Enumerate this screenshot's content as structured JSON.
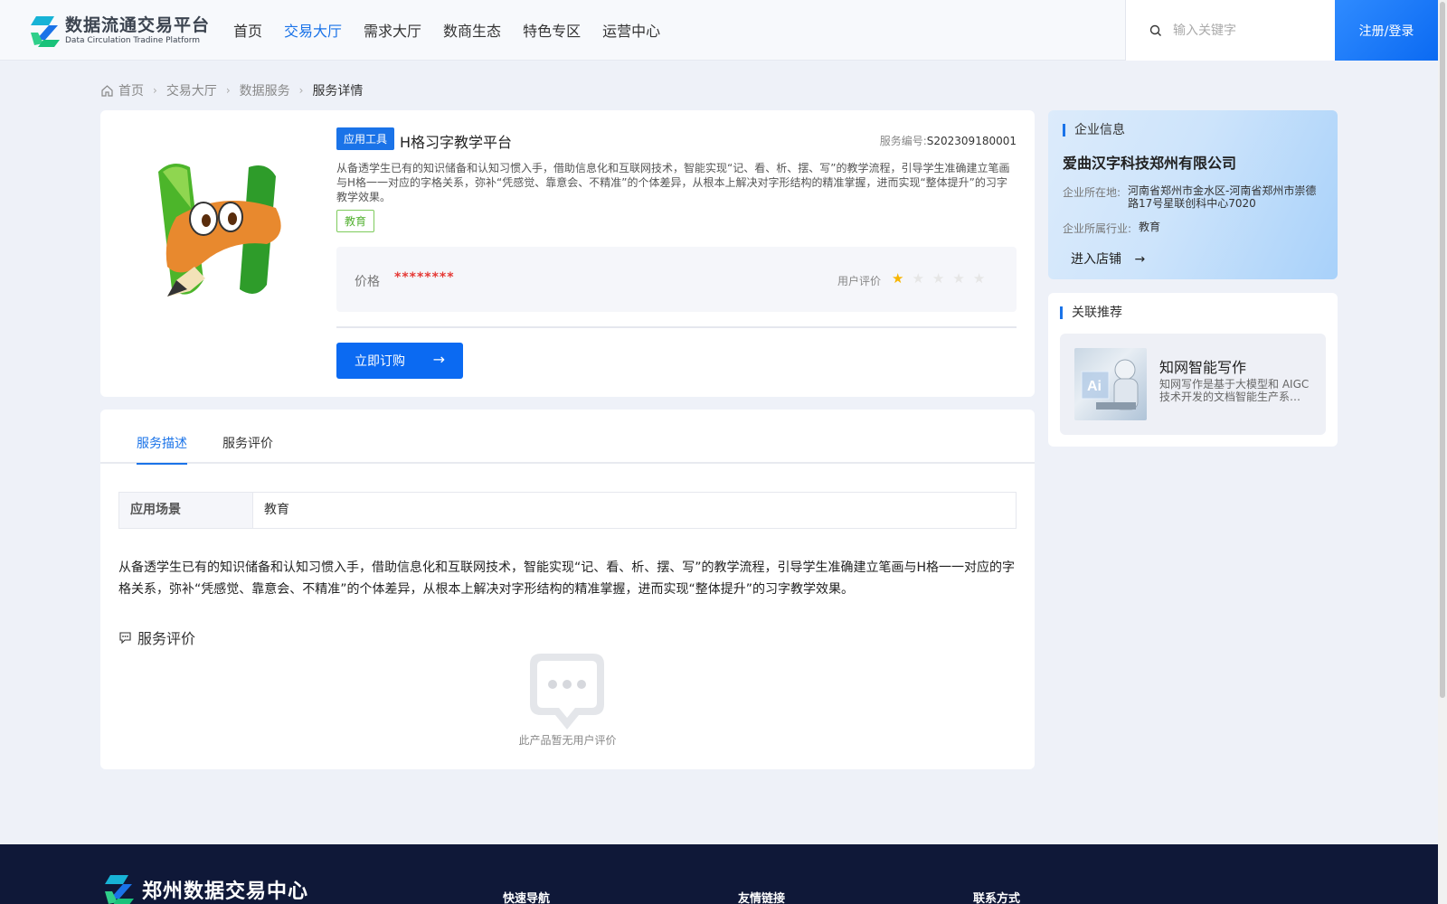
{
  "header": {
    "logo_cn": "数据流通交易平台",
    "logo_en": "Data Circulation Tradine Platform",
    "nav": [
      {
        "label": "首页",
        "active": false
      },
      {
        "label": "交易大厅",
        "active": true
      },
      {
        "label": "需求大厅",
        "active": false
      },
      {
        "label": "数商生态",
        "active": false
      },
      {
        "label": "特色专区",
        "active": false
      },
      {
        "label": "运营中心",
        "active": false
      }
    ],
    "search_placeholder": "输入关键字",
    "login_label": "注册/登录"
  },
  "breadcrumb": [
    "首页",
    "交易大厅",
    "数据服务",
    "服务详情"
  ],
  "product": {
    "category_tag": "应用工具",
    "title": "H格习字教学平台",
    "service_no_label": "服务编号:",
    "service_no": "S202309180001",
    "description": "从备透学生已有的知识储备和认知习惯入手，借助信息化和互联网技术，智能实现“记、看、析、摆、写”的教学流程，引导学生准确建立笔画与H格一一对应的字格关系，弥补“凭感觉、靠意会、不精准”的个体差异，从根本上解决对字形结构的精准掌握，进而实现“整体提升”的习字教学效果。",
    "industry_tag": "教育",
    "price_label": "价格",
    "price_value": "********",
    "rating_label": "用户评价",
    "rating": 1,
    "rating_max": 5,
    "buy_label": "立即订购"
  },
  "company": {
    "section_title": "企业信息",
    "name": "爱曲汉字科技郑州有限公司",
    "location_label": "企业所在地:",
    "location": "河南省郑州市金水区-河南省郑州市崇德路17号星联创科中心7020",
    "industry_label": "企业所属行业:",
    "industry": "教育",
    "enter_shop_label": "进入店铺"
  },
  "recommend": {
    "section_title": "关联推荐",
    "items": [
      {
        "title": "知网智能写作",
        "desc": "知网写作是基于大模型和 AIGC 技术开发的文档智能生产系…",
        "thumb_text": "Ai"
      }
    ]
  },
  "details": {
    "tabs": [
      {
        "label": "服务描述",
        "active": true
      },
      {
        "label": "服务评价",
        "active": false
      }
    ],
    "scene_label": "应用场景",
    "scene_value": "教育",
    "description": "从备透学生已有的知识储备和认知习惯入手，借助信息化和互联网技术，智能实现“记、看、析、摆、写”的教学流程，引导学生准确建立笔画与H格一一对应的字格关系，弥补“凭感觉、靠意会、不精准”的个体差异，从根本上解决对字形结构的精准掌握，进而实现“整体提升”的习字教学效果。",
    "review_title": "服务评价",
    "empty_text": "此产品暂无用户评价"
  },
  "footer": {
    "logo_text": "郑州数据交易中心",
    "columns": [
      "快速导航",
      "友情链接",
      "联系方式"
    ]
  },
  "colors": {
    "accent": "#1a73e8",
    "price": "#e53935",
    "star_on": "#f7b500",
    "footer_bg": "#0f1838"
  }
}
